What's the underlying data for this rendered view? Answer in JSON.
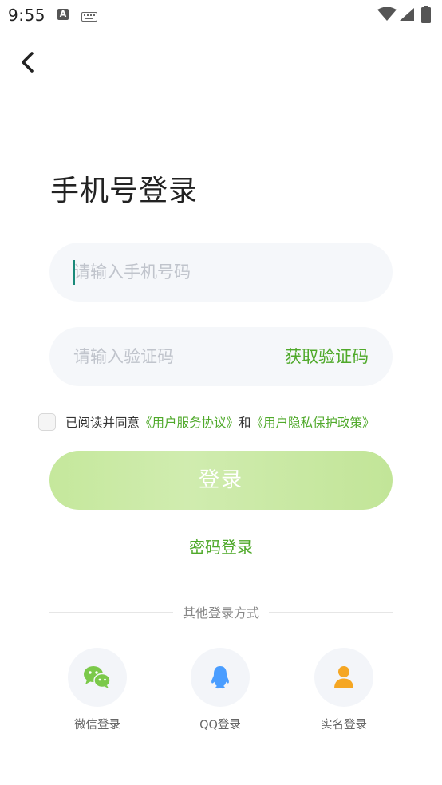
{
  "status_bar": {
    "time": "9:55",
    "notification_icon_letter": "A"
  },
  "header": {
    "back_icon": "chevron-left-icon"
  },
  "title": "手机号登录",
  "phone_input": {
    "placeholder": "请输入手机号码",
    "value": ""
  },
  "code_input": {
    "placeholder": "请输入验证码",
    "value": "",
    "get_code_label": "获取验证码"
  },
  "agreement": {
    "checked": false,
    "prefix": "已阅读并同意",
    "service_link": "《用户服务协议》",
    "and": "和",
    "privacy_link": "《用户隐私保护政策》"
  },
  "login_button_label": "登录",
  "password_login_label": "密码登录",
  "other_login": {
    "divider_text": "其他登录方式",
    "methods": [
      {
        "label": "微信登录",
        "icon": "wechat-icon",
        "color": "#7bc94a"
      },
      {
        "label": "QQ登录",
        "icon": "qq-penguin-icon",
        "color": "#4a9dff"
      },
      {
        "label": "实名登录",
        "icon": "person-icon",
        "color": "#f5a623"
      }
    ]
  },
  "colors": {
    "accent_green": "#4fa92a",
    "login_button_bg": "#c5e89c",
    "input_bg": "#f5f7fa",
    "caret": "#1a8a7a"
  }
}
